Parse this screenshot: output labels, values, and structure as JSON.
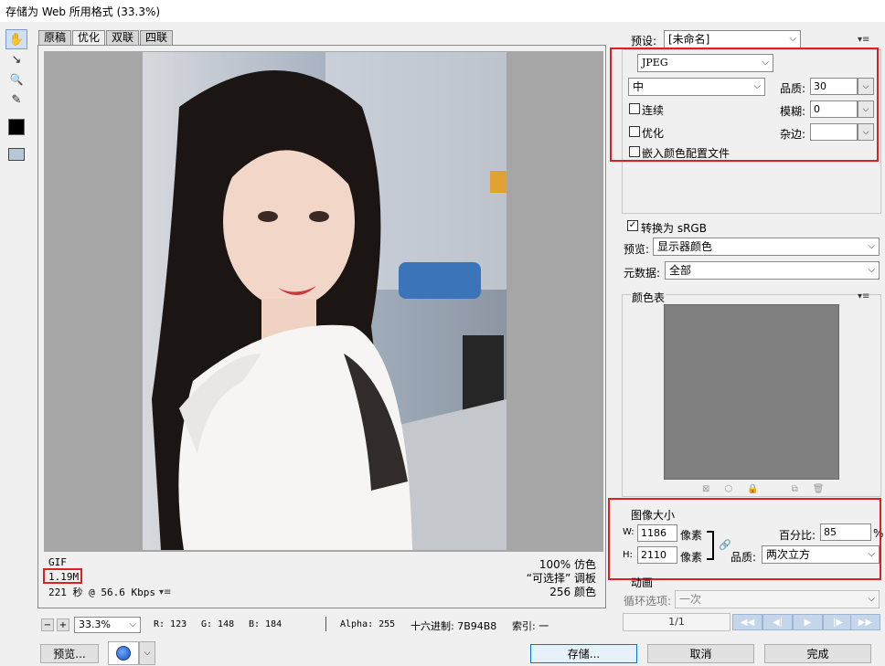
{
  "window": {
    "title": "存储为 Web 所用格式 (33.3%)"
  },
  "toolbar": {
    "tools": [
      {
        "name": "hand-tool",
        "glyph": "✋"
      },
      {
        "name": "slice-select-tool",
        "glyph": "↘"
      },
      {
        "name": "zoom-tool",
        "glyph": "🔍"
      },
      {
        "name": "eyedropper-tool",
        "glyph": "✎"
      }
    ]
  },
  "tabs": [
    "原稿",
    "优化",
    "双联",
    "四联"
  ],
  "image_info": {
    "format": "GIF",
    "size": "1.19M",
    "time": "221 秒 @ 56.6 Kbps",
    "dither": "100% 仿色",
    "palette": "“可选择” 调板",
    "colors": "256 颜色"
  },
  "status": {
    "zoom": "33.3%",
    "r": "R: 123",
    "g": "G: 148",
    "b": "B: 184",
    "alpha": "Alpha: 255",
    "hex": "十六进制: 7B94B8",
    "index": "索引: 一"
  },
  "bottom_buttons": {
    "preview": "预览...",
    "save": "存储...",
    "cancel": "取消",
    "done": "完成"
  },
  "settings": {
    "preset_label": "预设:",
    "preset_value": "[未命名]",
    "format": "JPEG",
    "quality_level": "中",
    "quality_label": "品质:",
    "quality_value": "30",
    "blur_label": "模糊:",
    "blur_value": "0",
    "matte_label": "杂边:",
    "progressive": "连续",
    "optimized": "优化",
    "embed_profile": "嵌入颜色配置文件",
    "convert_srgb": "转换为 sRGB",
    "preview_label": "预览:",
    "preview_value": "显示器颜色",
    "metadata_label": "元数据:",
    "metadata_value": "全部",
    "color_table_label": "颜色表"
  },
  "image_size": {
    "label": "图像大小",
    "w_label": "W:",
    "w_value": "1186",
    "w_unit": "像素",
    "h_label": "H:",
    "h_value": "2110",
    "h_unit": "像素",
    "percent_label": "百分比:",
    "percent_value": "85",
    "percent_unit": "%",
    "quality_label": "品质:",
    "quality_value": "两次立方"
  },
  "animation": {
    "label": "动画",
    "loop_label": "循环选项:",
    "loop_value": "一次",
    "frame": "1/1"
  },
  "colors": {
    "highlight": "#e02020",
    "accent": "#0078d7"
  }
}
